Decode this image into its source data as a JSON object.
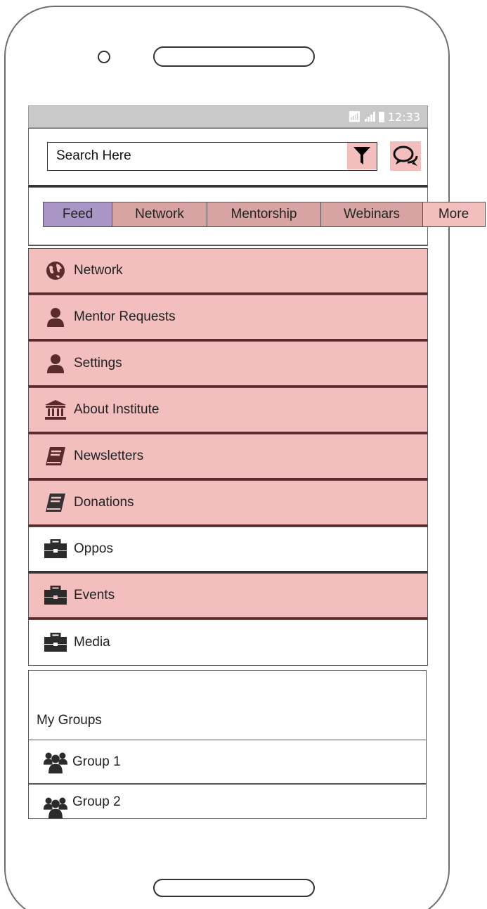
{
  "status_bar": {
    "time": "12:33",
    "wifi_icon": "wifi-icon",
    "signal_icon": "signal-icon",
    "battery_icon": "battery-icon"
  },
  "search": {
    "placeholder": "Search Here",
    "filter_icon": "filter-icon",
    "chat_icon": "chat-icon"
  },
  "tabs": [
    {
      "label": "Feed",
      "active": true
    },
    {
      "label": "Network",
      "active": false
    },
    {
      "label": "Mentorship",
      "active": false
    },
    {
      "label": "Webinars",
      "active": false
    },
    {
      "label": "More",
      "active": false
    }
  ],
  "menu": [
    {
      "label": "Network",
      "icon": "globe-icon",
      "highlighted": true
    },
    {
      "label": "Mentor Requests",
      "icon": "user-icon",
      "highlighted": true
    },
    {
      "label": "Settings",
      "icon": "user-icon",
      "highlighted": true
    },
    {
      "label": "About Institute",
      "icon": "institution-icon",
      "highlighted": true
    },
    {
      "label": "Newsletters",
      "icon": "book-icon",
      "highlighted": true
    },
    {
      "label": "Donations",
      "icon": "book-icon",
      "highlighted": true
    },
    {
      "label": "Oppos",
      "icon": "briefcase-icon",
      "highlighted": false
    },
    {
      "label": "Events",
      "icon": "briefcase-icon",
      "highlighted": true
    },
    {
      "label": "Media",
      "icon": "briefcase-icon",
      "highlighted": false
    }
  ],
  "groups": {
    "title": "My Groups",
    "items": [
      {
        "label": "Group 1",
        "icon": "users-icon"
      },
      {
        "label": "Group 2",
        "icon": "users-icon"
      }
    ]
  },
  "colors": {
    "highlight": "#f2bebe",
    "active_tab": "#a995c6",
    "inactive_tab": "#d8a3a3",
    "icon_maroon": "#5a2b2b",
    "status_bar": "#c9c9c9"
  }
}
